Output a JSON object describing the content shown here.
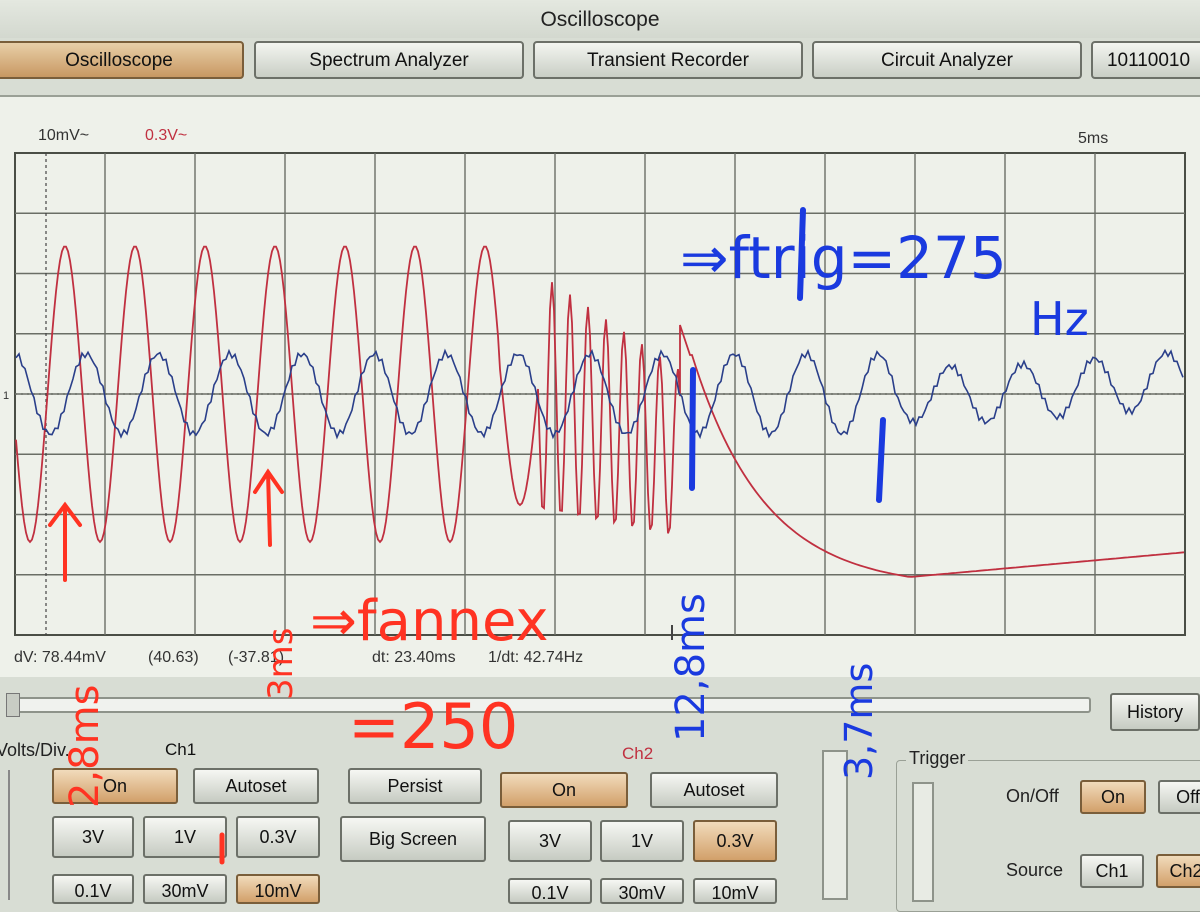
{
  "window": {
    "title": "Oscilloscope"
  },
  "tabs": [
    {
      "label": "Oscilloscope",
      "active": true
    },
    {
      "label": "Spectrum Analyzer",
      "active": false
    },
    {
      "label": "Transient Recorder",
      "active": false
    },
    {
      "label": "Circuit Analyzer",
      "active": false
    },
    {
      "label": "10110010",
      "active": false
    }
  ],
  "scope": {
    "ch1_scale": "10mV~",
    "ch2_scale": "0.3V~",
    "time_scale": "5ms",
    "zero_marker": "1",
    "ch1_color": "#2a3f8a",
    "ch2_color": "#c03040",
    "readout": {
      "dv": "dV: 78.44mV",
      "dv_a": "(40.63)",
      "dv_b": "(-37.81)",
      "dt": "dt: 23.40ms",
      "inv_dt": "1/dt: 42.74Hz"
    }
  },
  "history_label": "History",
  "controls": {
    "volts_div_label": "Volts/Div.",
    "ch1": {
      "label": "Ch1",
      "on": "On",
      "autoset": "Autoset",
      "v3": "3V",
      "v1": "1V",
      "v03": "0.3V",
      "v01": "0.1V",
      "v30m": "30mV",
      "v10m": "10mV",
      "selected": "10mV"
    },
    "persist": "Persist",
    "big_screen": "Big Screen",
    "ch2": {
      "label": "Ch2",
      "on": "On",
      "autoset": "Autoset",
      "v3": "3V",
      "v1": "1V",
      "v03": "0.3V",
      "v01": "0.1V",
      "v30m": "30mV",
      "v10m": "10mV",
      "selected": "0.3V"
    },
    "trigger": {
      "label": "Trigger",
      "onoff_label": "On/Off",
      "on": "On",
      "off": "Off",
      "source_label": "Source",
      "source_ch1": "Ch1",
      "source_ch2": "Ch2"
    }
  },
  "handwriting": {
    "ftrig": "⇒ftrig=275",
    "hz": "Hz",
    "fannex": "⇒fannex",
    "eq250": "=250",
    "dt1": "12,8ms",
    "dt2": "3,7ms",
    "left1": "3ms",
    "left2": "2,8ms"
  }
}
